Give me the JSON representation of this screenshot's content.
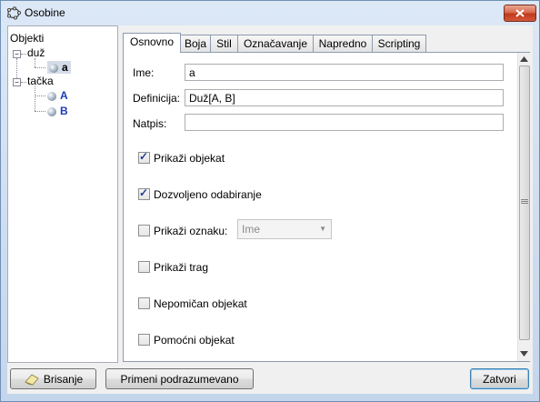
{
  "window": {
    "title": "Osobine"
  },
  "tree": {
    "root": "Objekti",
    "groups": [
      {
        "label": "duž",
        "items": [
          "a"
        ]
      },
      {
        "label": "tačka",
        "items": [
          "A",
          "B"
        ]
      }
    ]
  },
  "tabs": [
    "Osnovno",
    "Boja",
    "Stil",
    "Označavanje",
    "Napredno",
    "Scripting"
  ],
  "basic": {
    "name_label": "Ime:",
    "name_value": "a",
    "definition_label": "Definicija:",
    "definition_value": "Duž[A, B]",
    "caption_label": "Natpis:",
    "caption_value": "",
    "show_object": "Prikaži objekat",
    "selection_allowed": "Dozvoljeno odabiranje",
    "show_label": "Prikaži oznaku:",
    "label_mode": "Ime",
    "show_trace": "Prikaži trag",
    "fix_object": "Nepomičan objekat",
    "auxiliary_object": "Pomoćni objekat"
  },
  "checks": {
    "show_object": true,
    "selection_allowed": true,
    "show_label": false,
    "show_trace": false,
    "fix_object": false,
    "auxiliary_object": false
  },
  "footer": {
    "delete": "Brisanje",
    "defaults": "Primeni podrazumevano",
    "close": "Zatvori"
  }
}
